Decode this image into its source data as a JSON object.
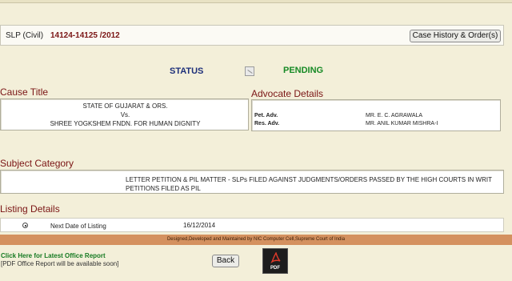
{
  "case": {
    "type": "SLP (Civil)",
    "number": "14124-14125 /2012",
    "history_button": "Case History & Order(s)"
  },
  "status": {
    "label": "STATUS",
    "value": "PENDING"
  },
  "cause_title": {
    "heading": "Cause Title",
    "petitioner": "STATE OF GUJARAT & ORS.",
    "versus": "Vs.",
    "respondent": "SHREE YOGKSHEM FNDN. FOR HUMAN DIGNITY"
  },
  "advocate_details": {
    "heading": "Advocate Details",
    "pet_label": "Pet. Adv.",
    "pet_value": "MR. E. C. AGRAWALA",
    "res_label": "Res. Adv.",
    "res_value": "MR. ANIL KUMAR MISHRA-I"
  },
  "subject_category": {
    "heading": "Subject Category",
    "text": "LETTER PETITION & PIL MATTER - SLPs FILED AGAINST JUDGMENTS/ORDERS PASSED BY THE HIGH COURTS IN WRIT PETITIONS FILED AS PIL"
  },
  "listing_details": {
    "heading": "Listing Details",
    "label": "Next Date of Listing",
    "value": "16/12/2014"
  },
  "footer": {
    "credit": "Designed,Developed and Maintained by NIC Computer Cell,Supreme Court of India"
  },
  "office_report": {
    "link": "Click Here for Latest Office Report",
    "note": "[PDF Office Report will be available soon]"
  },
  "actions": {
    "back": "Back",
    "pdf_label": "PDF"
  },
  "icons": {
    "status_icon": "status-image-icon",
    "radio": "radio-selected-icon",
    "pdf": "adobe-pdf-icon"
  },
  "colors": {
    "background": "#f3efd9",
    "heading": "#7a1414",
    "status_label": "#1d2f7a",
    "status_value": "#168a25",
    "footer_bar": "#d4915f",
    "link": "#167a22"
  }
}
